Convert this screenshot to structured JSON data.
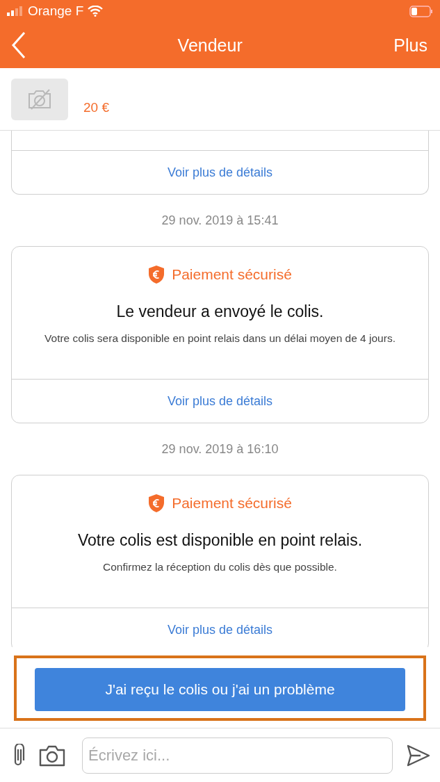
{
  "status_bar": {
    "carrier": "Orange F"
  },
  "nav": {
    "title": "Vendeur",
    "action": "Plus"
  },
  "product": {
    "price": "20 €"
  },
  "messages": [
    {
      "kind": "partial_card",
      "link": "Voir plus de détails"
    },
    {
      "kind": "timestamp",
      "text": "29 nov. 2019 à 15:41"
    },
    {
      "kind": "card",
      "badge": "Paiement sécurisé",
      "title": "Le vendeur a envoyé le colis.",
      "body": "Votre colis sera disponible en point relais dans un délai moyen de 4 jours.",
      "link": "Voir plus de détails"
    },
    {
      "kind": "timestamp",
      "text": "29 nov. 2019 à 16:10"
    },
    {
      "kind": "card",
      "badge": "Paiement sécurisé",
      "title": "Votre colis est disponible en point relais.",
      "body": "Confirmez la réception du colis dès que possible.",
      "link": "Voir plus de détails"
    }
  ],
  "action_button": {
    "label": "J'ai reçu le colis ou j'ai un problème"
  },
  "composer": {
    "placeholder": "Écrivez ici..."
  }
}
